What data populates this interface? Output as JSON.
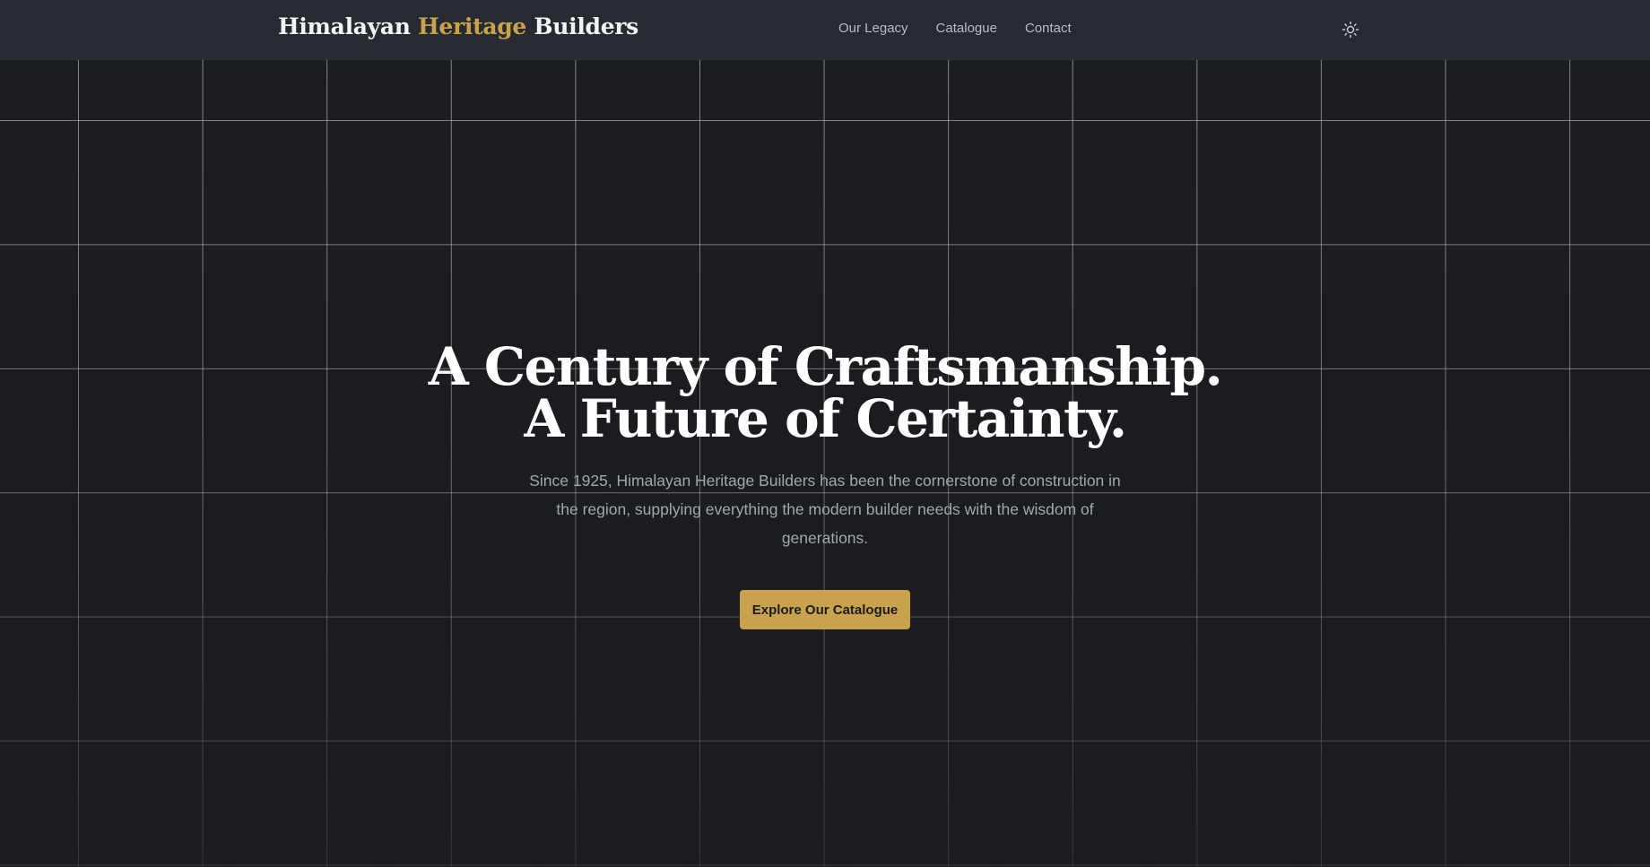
{
  "header": {
    "brand": {
      "part1": "Himalayan ",
      "accent": "Heritage",
      "part2": " Builders"
    },
    "nav": [
      {
        "label": "Our Legacy"
      },
      {
        "label": "Catalogue"
      },
      {
        "label": "Contact"
      }
    ],
    "theme_toggle_icon": "sun-icon"
  },
  "hero": {
    "title_line1": "A Century of Craftsmanship.",
    "title_line2": "A Future of Certainty.",
    "subtitle": "Since 1925, Himalayan Heritage Builders has been the cornerstone of construction in the region, supplying everything the modern builder needs with the wisdom of generations.",
    "cta_label": "Explore Our Catalogue"
  },
  "colors": {
    "background": "#1b1c20",
    "header": "#272a30",
    "accent": "#c9a24e",
    "text": "#ffffff",
    "muted": "#a2a6ad"
  }
}
